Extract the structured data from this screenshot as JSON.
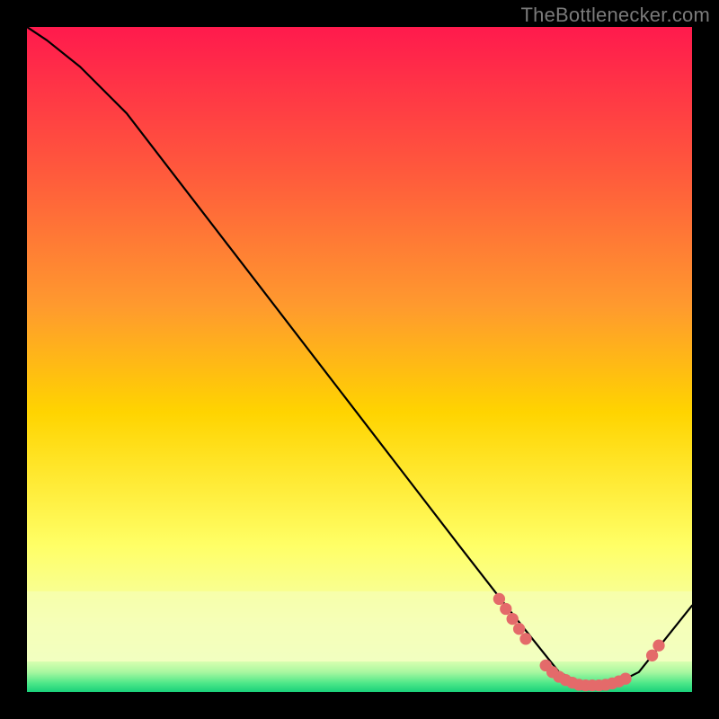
{
  "watermark": "TheBottlenecker.com",
  "chart_data": {
    "type": "line",
    "title": "",
    "xlabel": "",
    "ylabel": "",
    "xlim": [
      0,
      100
    ],
    "ylim": [
      0,
      100
    ],
    "legend": false,
    "grid": false,
    "background_gradient": {
      "top": "#ff1a4d",
      "mid_upper": "#ff8a33",
      "mid": "#ffd400",
      "mid_lower": "#ffff66",
      "band": "#f4ffb0",
      "bottom": "#19e07a"
    },
    "series": [
      {
        "name": "curve",
        "color": "#000000",
        "x": [
          0,
          3,
          8,
          15,
          25,
          35,
          45,
          55,
          65,
          72,
          76,
          80,
          84,
          88,
          92,
          96,
          100
        ],
        "y": [
          100,
          98,
          94,
          87,
          74,
          61,
          48,
          35,
          22,
          13,
          8,
          3,
          1,
          1,
          3,
          8,
          13
        ]
      }
    ],
    "markers": [
      {
        "name": "dots",
        "color": "#e46a6a",
        "radius_pct": 0.9,
        "points": [
          {
            "x": 71,
            "y": 14
          },
          {
            "x": 72,
            "y": 12.5
          },
          {
            "x": 73,
            "y": 11
          },
          {
            "x": 74,
            "y": 9.5
          },
          {
            "x": 75,
            "y": 8
          },
          {
            "x": 78,
            "y": 4
          },
          {
            "x": 79,
            "y": 3
          },
          {
            "x": 80,
            "y": 2.3
          },
          {
            "x": 81,
            "y": 1.8
          },
          {
            "x": 82,
            "y": 1.4
          },
          {
            "x": 83,
            "y": 1.1
          },
          {
            "x": 84,
            "y": 1.0
          },
          {
            "x": 85,
            "y": 1.0
          },
          {
            "x": 86,
            "y": 1.0
          },
          {
            "x": 87,
            "y": 1.1
          },
          {
            "x": 88,
            "y": 1.3
          },
          {
            "x": 89,
            "y": 1.6
          },
          {
            "x": 90,
            "y": 2.0
          },
          {
            "x": 94,
            "y": 5.5
          },
          {
            "x": 95,
            "y": 7.0
          }
        ]
      }
    ]
  }
}
